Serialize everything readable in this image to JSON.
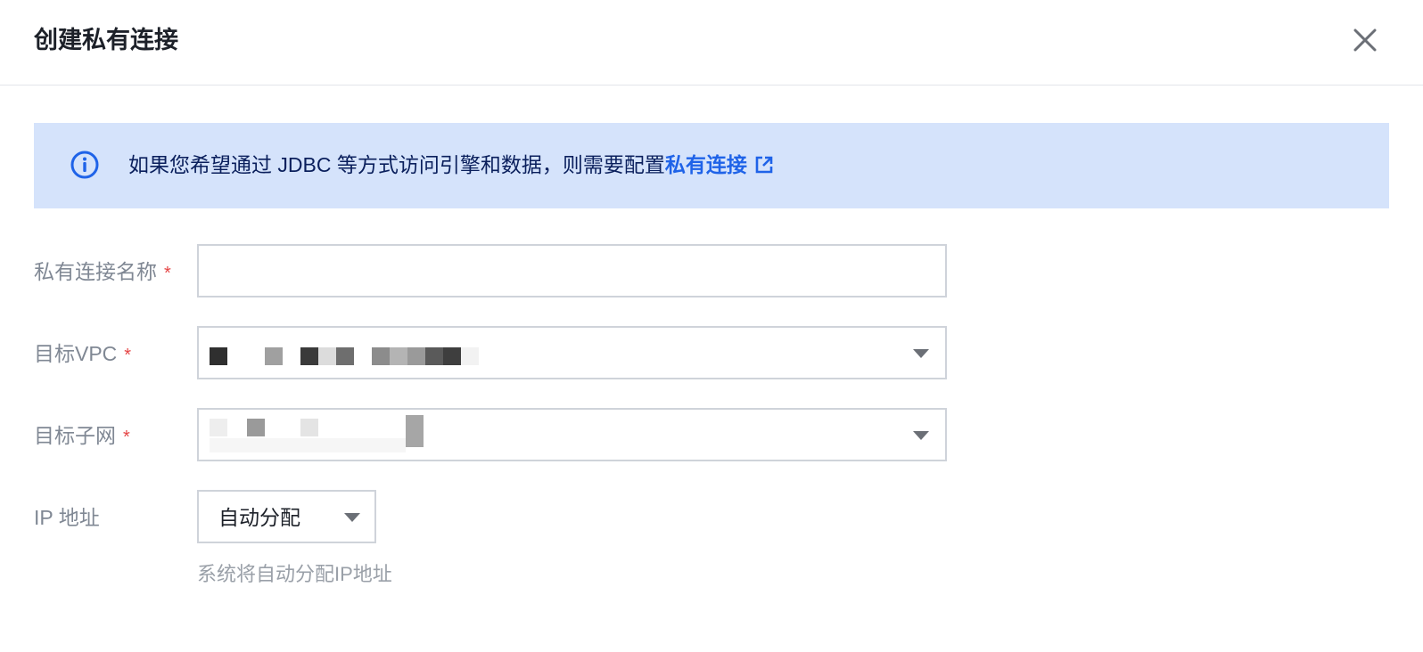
{
  "dialog": {
    "title": "创建私有连接"
  },
  "notice": {
    "text": "如果您希望通过 JDBC 等方式访问引擎和数据，则需要配置",
    "link_label": "私有连接"
  },
  "form": {
    "name": {
      "label": "私有连接名称",
      "required_mark": "*",
      "value": ""
    },
    "vpc": {
      "label": "目标VPC",
      "required_mark": "*"
    },
    "subnet": {
      "label": "目标子网",
      "required_mark": "*"
    },
    "ip": {
      "label": "IP 地址",
      "value": "自动分配",
      "hint": "系统将自动分配IP地址"
    }
  },
  "icons": {
    "close": "close-icon",
    "info": "info-icon",
    "external_link": "external-link-icon",
    "dropdown": "chevron-down-icon"
  },
  "colors": {
    "notice_background": "#d5e3fb",
    "link": "#1f63e8",
    "required": "#e54545"
  }
}
